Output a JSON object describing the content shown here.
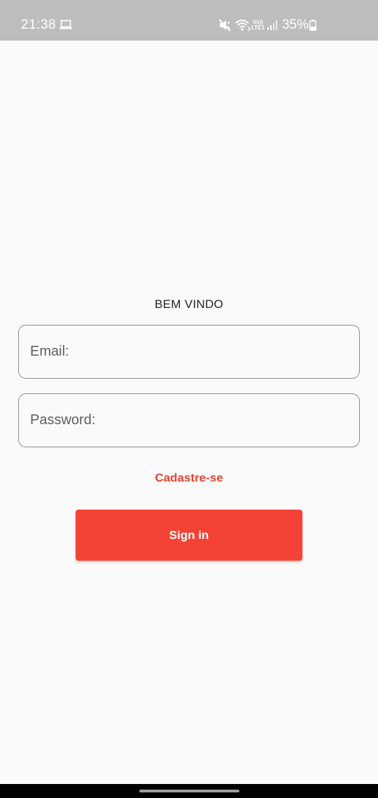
{
  "status_bar": {
    "time": "21:38",
    "battery": "35%",
    "volte_line1": "Vo))",
    "volte_line2": "LTE1",
    "icons": [
      "laptop-icon",
      "mute-icon",
      "wifi-icon",
      "volte-icon",
      "signal-icon",
      "battery-icon"
    ]
  },
  "login": {
    "welcome_text": "BEM VINDO",
    "email_placeholder": "Email:",
    "password_placeholder": "Password:",
    "signup_link": "Cadastre-se",
    "signin_button": "Sign in"
  },
  "colors": {
    "accent": "#f44336",
    "link": "#e74536",
    "status_bar": "#bdbdbd",
    "background": "#fafafa"
  }
}
